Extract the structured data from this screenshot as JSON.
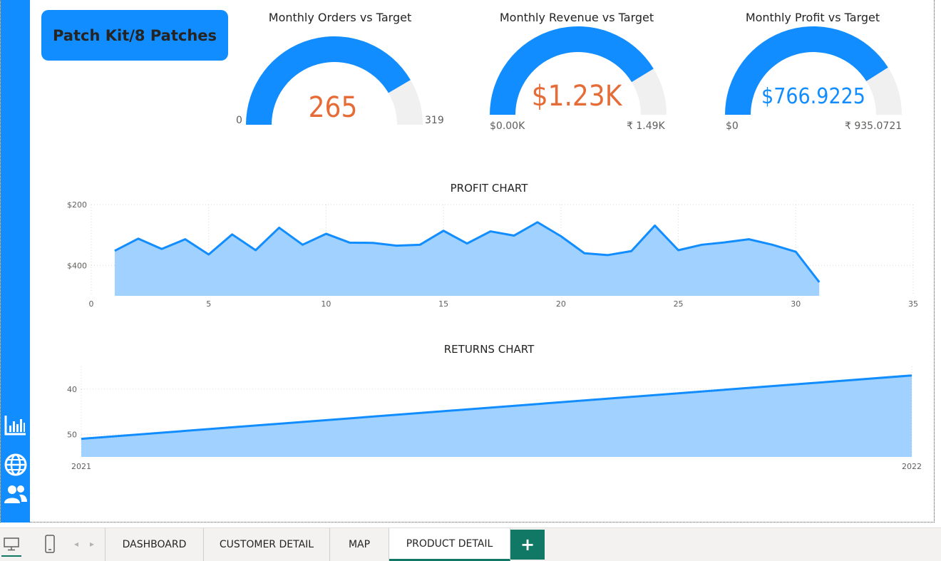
{
  "product_title": "Patch Kit/8 Patches",
  "gauges": [
    {
      "title": "Monthly Orders vs Target",
      "value_text": "265",
      "min_text": "0",
      "max_text": "319",
      "value": 265,
      "max": 319,
      "value_color": "#E66C37"
    },
    {
      "title": "Monthly Revenue vs Target",
      "value_text": "$1.23K",
      "min_text": "$0.00K",
      "max_text": "₹ 1.49K",
      "value": 1230,
      "max": 1490,
      "value_color": "#E66C37"
    },
    {
      "title": "Monthly Profit vs Target",
      "value_text": "$766.9225",
      "min_text": "$0",
      "max_text": "₹ 935.0721",
      "value": 766.9225,
      "max": 935.0721,
      "value_color": "#118DFF"
    }
  ],
  "colors": {
    "accent": "#118DFF",
    "area_fill": "#A0D1FF",
    "track": "#F0F0F0",
    "tab_active": "#117865"
  },
  "profit_chart": {
    "title": "PROFIT CHART",
    "chart_data": {
      "type": "area",
      "x": [
        1,
        2,
        3,
        4,
        5,
        6,
        7,
        8,
        9,
        10,
        11,
        12,
        13,
        14,
        15,
        16,
        17,
        18,
        19,
        20,
        21,
        22,
        23,
        24,
        25,
        26,
        27,
        28,
        29,
        30,
        31
      ],
      "values": [
        248,
        288,
        254,
        286,
        236,
        302,
        250,
        324,
        268,
        304,
        275,
        274,
        265,
        268,
        314,
        272,
        312,
        298,
        342,
        296,
        240,
        234,
        247,
        331,
        250,
        268,
        276,
        286,
        268,
        245,
        145
      ],
      "x_ticks": [
        "0",
        "5",
        "10",
        "15",
        "20",
        "25",
        "30",
        "35"
      ],
      "y_ticks": [
        "$200",
        "$400"
      ],
      "xlim": [
        0,
        35
      ],
      "ylim": [
        100,
        400
      ],
      "grid": true
    }
  },
  "returns_chart": {
    "title": "RETURNS CHART",
    "chart_data": {
      "type": "area",
      "x": [
        "2021",
        "2022"
      ],
      "values": [
        39,
        53
      ],
      "x_ticks": [
        "2021",
        "2022"
      ],
      "y_ticks": [
        "40",
        "50"
      ],
      "ylim": [
        35,
        55
      ],
      "grid": true
    }
  },
  "sidebar": {
    "icons": [
      "bar-chart-icon",
      "globe-icon",
      "users-icon"
    ]
  },
  "tabs": [
    {
      "label": "DASHBOARD",
      "active": false
    },
    {
      "label": "CUSTOMER DETAIL",
      "active": false
    },
    {
      "label": "MAP",
      "active": false
    },
    {
      "label": "PRODUCT DETAIL",
      "active": true
    }
  ],
  "add_tab_label": "+"
}
